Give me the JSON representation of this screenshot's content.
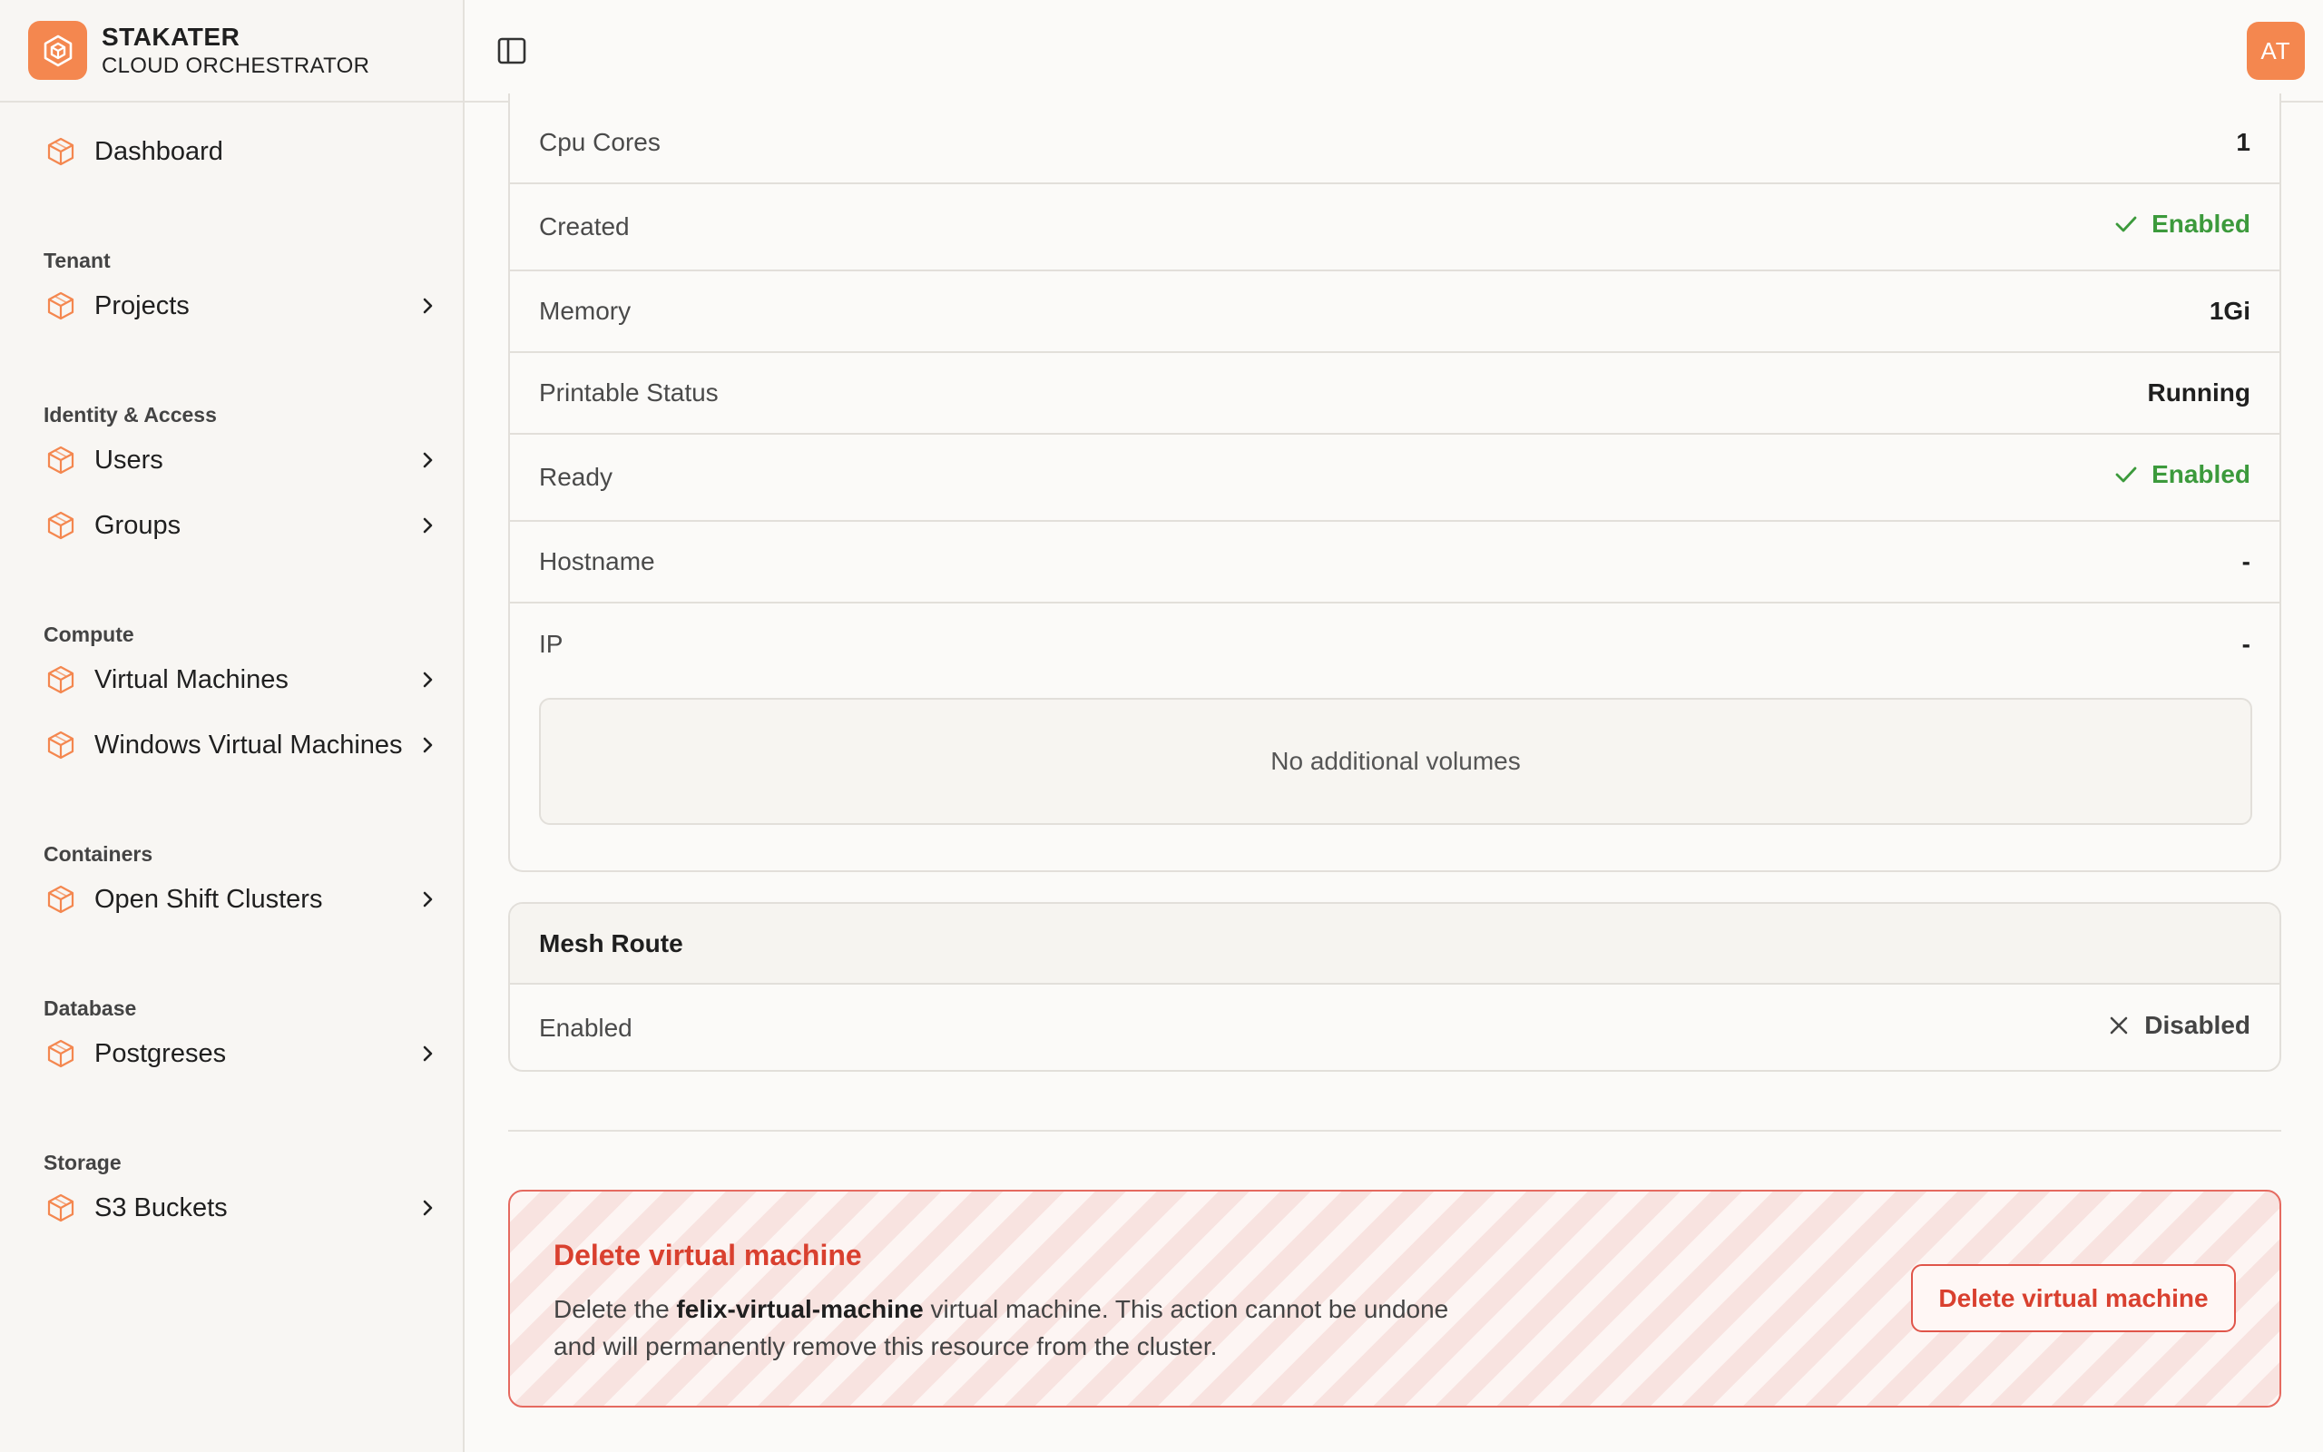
{
  "brand": {
    "name": "STAKATER",
    "subtitle": "CLOUD ORCHESTRATOR",
    "accent_color": "#f4874f"
  },
  "header": {
    "sidebar_toggle_icon": "sidebar-toggle-icon",
    "avatar_initials": "AT"
  },
  "sidebar": {
    "dashboard": "Dashboard",
    "sections": {
      "tenant": "Tenant",
      "identity": "Identity & Access",
      "compute": "Compute",
      "containers": "Containers",
      "database": "Database",
      "storage": "Storage"
    },
    "items": {
      "projects": "Projects",
      "users": "Users",
      "groups": "Groups",
      "virtual_machines": "Virtual Machines",
      "windows_virtual_machines": "Windows Virtual Machines",
      "openshift_clusters": "Open Shift Clusters",
      "postgreses": "Postgreses",
      "s3_buckets": "S3 Buckets"
    },
    "item_icon": "cube-icon",
    "chevron_icon": "chevron-right-icon"
  },
  "details": {
    "rows": [
      {
        "label": "Cpu Cores",
        "value": "1"
      },
      {
        "label": "Created",
        "value": "Enabled",
        "status": "enabled"
      },
      {
        "label": "Memory",
        "value": "1Gi"
      },
      {
        "label": "Printable Status",
        "value": "Running"
      },
      {
        "label": "Ready",
        "value": "Enabled",
        "status": "enabled"
      },
      {
        "label": "Hostname",
        "value": "-"
      },
      {
        "label": "IP",
        "value": "-"
      }
    ],
    "volumes_empty": "No additional volumes"
  },
  "mesh_route": {
    "title": "Mesh Route",
    "row_label": "Enabled",
    "row_value": "Disabled"
  },
  "danger_zone": {
    "title": "Delete virtual machine",
    "desc_prefix": "Delete the ",
    "vm_name": "felix-virtual-machine",
    "desc_suffix": " virtual machine. This action cannot be undone and will permanently remove this resource from the cluster.",
    "button_label": "Delete virtual machine",
    "color": "#d9402f"
  },
  "colors": {
    "enabled": "#3c9a3c",
    "border": "#e2dfda"
  }
}
